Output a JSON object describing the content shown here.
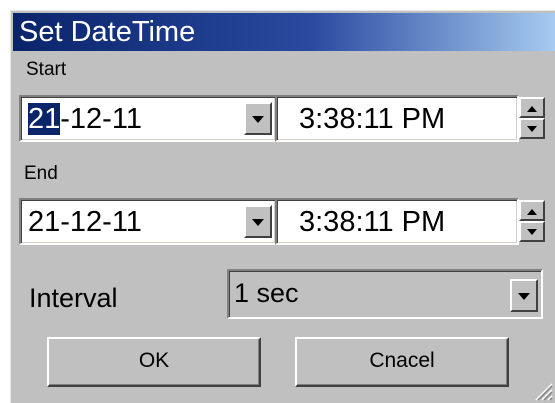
{
  "dialog": {
    "title": "Set DateTime",
    "start": {
      "label": "Start",
      "date_selected": "21",
      "date_rest": "-12-11",
      "time": "3:38:11 PM"
    },
    "end": {
      "label": "End",
      "date": "21-12-11",
      "time": "3:38:11 PM"
    },
    "interval": {
      "label": "Interval",
      "selected": "1 sec"
    },
    "buttons": {
      "ok": "OK",
      "cancel": "Cnacel"
    }
  },
  "icons": {
    "dropdown": "chevron-down-icon",
    "spin_up": "arrow-up-icon",
    "spin_down": "arrow-down-icon",
    "resize": "resize-grip-icon"
  },
  "colors": {
    "dialog_bg": "#c0c0c0",
    "title_gradient_start": "#0a246a",
    "title_gradient_end": "#a6caf0",
    "selection_bg": "#0a246a"
  }
}
